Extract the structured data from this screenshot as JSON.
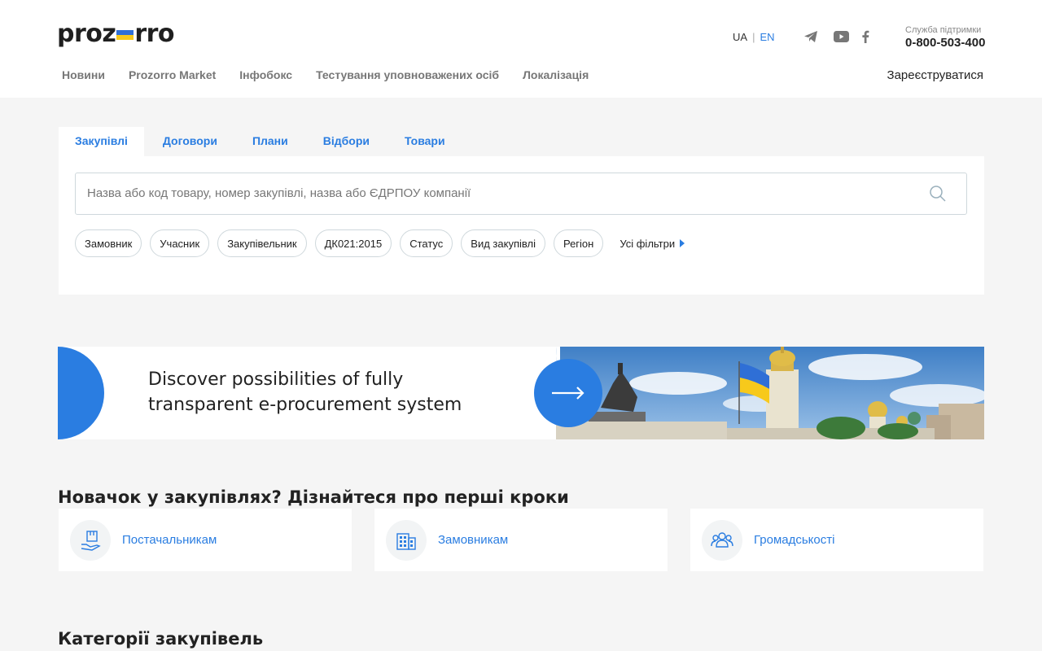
{
  "header": {
    "logo_text_left": "proz",
    "logo_text_right": "rro",
    "lang_ua": "UA",
    "lang_sep": "|",
    "lang_en": "EN",
    "support_label": "Служба підтримки",
    "support_phone": "0-800-503-400",
    "register_label": "Зареєструватися",
    "nav": [
      "Новини",
      "Prozorro Market",
      "Інфобокс",
      "Тестування уповноважених осіб",
      "Локалізація"
    ],
    "social_icons": [
      "telegram-icon",
      "youtube-icon",
      "facebook-icon"
    ]
  },
  "search": {
    "tabs": [
      "Закупівлі",
      "Договори",
      "Плани",
      "Відбори",
      "Товари"
    ],
    "active_tab": "Закупівлі",
    "placeholder": "Назва або код товару, номер закупівлі, назва або ЄДРПОУ компанії",
    "value": "",
    "filters": [
      "Замовник",
      "Учасник",
      "Закупівельник",
      "ДК021:2015",
      "Статус",
      "Вид закупівлі",
      "Регіон"
    ],
    "all_filters_label": "Усі фільтри"
  },
  "banner": {
    "line1": "Discover possibilities of fully",
    "line2": "transparent e-procurement system"
  },
  "newcomer": {
    "title": "Новачок у закупівлях? Дізнайтеся про перші кроки",
    "cards": [
      {
        "label": "Постачальникам",
        "icon": "box-hand-icon"
      },
      {
        "label": "Замовникам",
        "icon": "building-icon"
      },
      {
        "label": "Громадськості",
        "icon": "people-icon"
      }
    ]
  },
  "categories": {
    "title": "Категорії закупівель"
  },
  "colors": {
    "accent": "#2a7de1",
    "flag_blue": "#2f6fd6",
    "flag_yellow": "#f7c91b"
  }
}
